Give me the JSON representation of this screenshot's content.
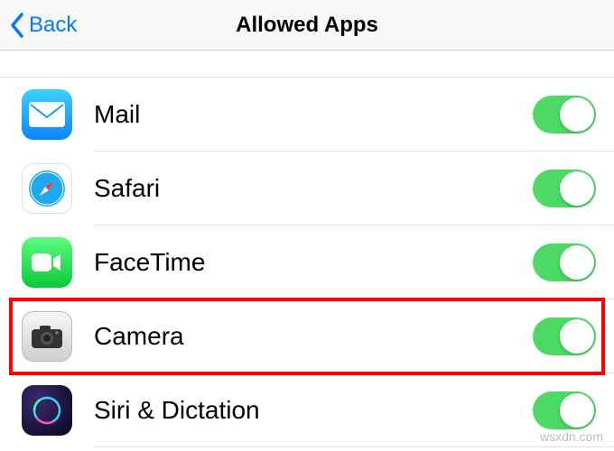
{
  "nav": {
    "back_label": "Back",
    "title": "Allowed Apps"
  },
  "apps": [
    {
      "id": "mail",
      "label": "Mail",
      "enabled": true,
      "highlighted": false
    },
    {
      "id": "safari",
      "label": "Safari",
      "enabled": true,
      "highlighted": false
    },
    {
      "id": "facetime",
      "label": "FaceTime",
      "enabled": true,
      "highlighted": false
    },
    {
      "id": "camera",
      "label": "Camera",
      "enabled": true,
      "highlighted": true
    },
    {
      "id": "siri",
      "label": "Siri & Dictation",
      "enabled": true,
      "highlighted": false
    }
  ],
  "watermark": "wsxdn.com",
  "colors": {
    "accent": "#007aff",
    "toggle_on": "#4cd964",
    "highlight_border": "#ff0000"
  }
}
